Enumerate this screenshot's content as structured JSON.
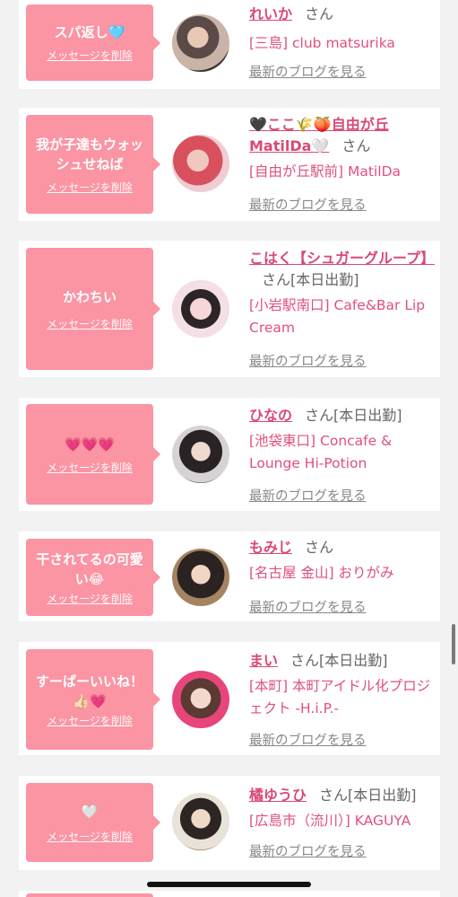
{
  "delete_label": "メッセージを削除",
  "blog_label": "最新のブログを見る",
  "accent": "#fb94a3",
  "name_color": "#d94a74",
  "messages": [
    {
      "text": "スパ返し🩵",
      "name": "れいか",
      "suffix": "さん",
      "shop": "[三島] club matsurika"
    },
    {
      "text": "我が子達もウォッシュせねば",
      "name": "🖤ここ🌾🍑自由が丘MatilDa🤍",
      "suffix": "さん",
      "shop": "[自由が丘駅前] MatilDa"
    },
    {
      "text": "かわちい",
      "name": "こはく【シュガーグループ】",
      "suffix": "さん[本日出勤]",
      "shop": "[小岩駅南口] Cafe&Bar Lip Cream"
    },
    {
      "text": "💗💗💗",
      "name": "ひなの",
      "suffix": "さん[本日出勤]",
      "shop": "[池袋東口] Concafe & Lounge Hi-Potion"
    },
    {
      "text": "干されてるの可愛い😂",
      "name": "もみじ",
      "suffix": "さん",
      "shop": "[名古屋 金山] おりがみ"
    },
    {
      "text": "すーぱーいいね！👍🏻💗",
      "name": "まい",
      "suffix": "さん[本日出勤]",
      "shop": "[本町] 本町アイドル化プロジェクト -H.i.P.-"
    },
    {
      "text": "🤍",
      "name": "橘ゆうひ",
      "suffix": "さん[本日出勤]",
      "shop": "[広島市（流川）] KAGUYA"
    }
  ]
}
